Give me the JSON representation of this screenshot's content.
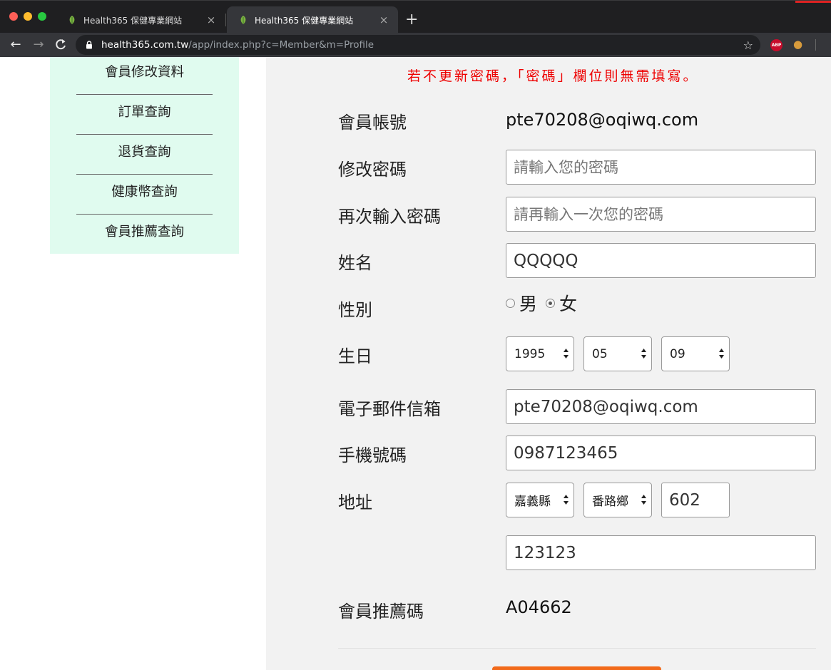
{
  "browser": {
    "tabs": [
      {
        "title": "Health365 保健專業網站",
        "close": "×"
      },
      {
        "title": "Health365 保健專業網站",
        "close": "×"
      }
    ],
    "new_tab": "+",
    "url_host": "health365.com.tw",
    "url_path": "/app/index.php?c=Member&m=Profile",
    "ext_abp_label": "ABP"
  },
  "sidebar": {
    "items": [
      {
        "label": "會員修改資料"
      },
      {
        "label": "訂單查詢"
      },
      {
        "label": "退貨查詢"
      },
      {
        "label": "健康幣查詢"
      },
      {
        "label": "會員推薦查詢"
      }
    ]
  },
  "form": {
    "notice": "若不更新密碼，「密碼」欄位則無需填寫。",
    "account_label": "會員帳號",
    "account_value": "pte70208@oqiwq.com",
    "password_label": "修改密碼",
    "password_placeholder": "請輸入您的密碼",
    "password_confirm_label": "再次輸入密碼",
    "password_confirm_placeholder": "請再輸入一次您的密碼",
    "name_label": "姓名",
    "name_value": "QQQQQ",
    "gender_label": "性別",
    "gender_male": "男",
    "gender_female": "女",
    "gender_selected": "female",
    "birthday_label": "生日",
    "birth_year": "1995",
    "birth_month": "05",
    "birth_day": "09",
    "email_label": "電子郵件信箱",
    "email_value": "pte70208@oqiwq.com",
    "phone_label": "手機號碼",
    "phone_value": "0987123465",
    "address_label": "地址",
    "county": "嘉義縣",
    "district": "番路鄉",
    "zip": "602",
    "address_value": "123123",
    "referral_label": "會員推薦碼",
    "referral_value": "A04662"
  },
  "colors": {
    "notice": "#ee0000",
    "sidebar_bg": "#e0fbef",
    "content_bg": "#f2f2f2",
    "submit": "#f26a1b"
  }
}
